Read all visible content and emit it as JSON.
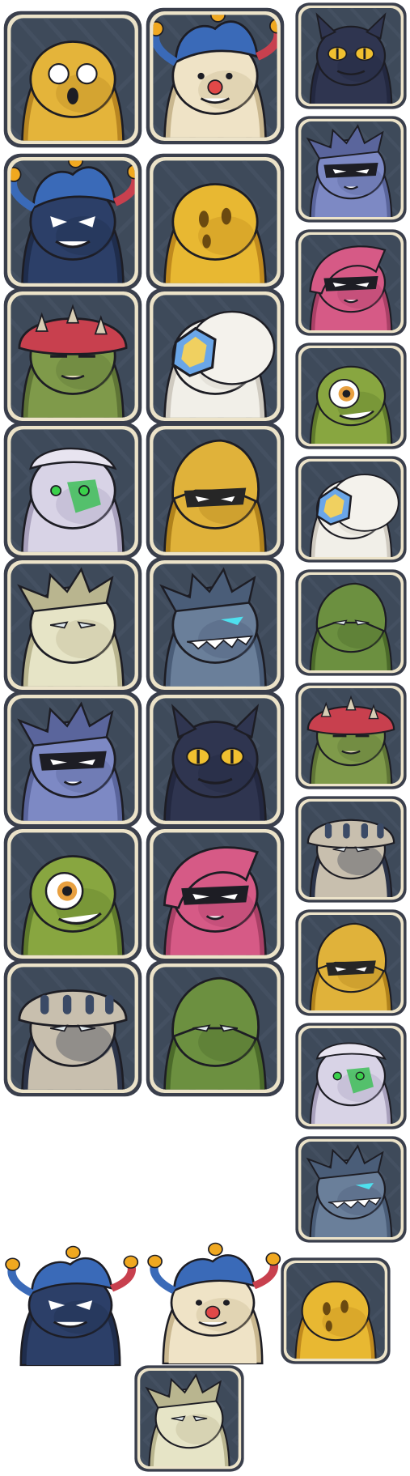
{
  "colors": {
    "frame_outer": "#3a3f4c",
    "frame_inner": "#ece3c9",
    "tile_bg": "#3e4a5a",
    "tile_pattern": "#4a5668",
    "outline": "#1d1d24"
  },
  "portraits": [
    {
      "col": 0,
      "row": 0,
      "creature": "yellow-blob-shocked-icon",
      "body": "#e4b43a",
      "shade": "#b88622",
      "eye": "white-round",
      "accent": "#ffffff",
      "framed": true
    },
    {
      "col": 1,
      "row": 0,
      "creature": "jester-clown-icon",
      "body": "#efe3c6",
      "shade": "#c9b78f",
      "eye": "dots",
      "accent": "#e04848",
      "hat": "jester",
      "framed": true
    },
    {
      "col": 2,
      "row": 0,
      "creature": "dark-cat-blob-icon",
      "body": "#2f3550",
      "shade": "#232840",
      "eye": "yellow-cat",
      "accent": "#f0c030",
      "horns": true,
      "framed": true
    },
    {
      "col": 0,
      "row": 1,
      "creature": "blue-jester-icon",
      "body": "#2c3f68",
      "shade": "#1f2d4c",
      "eye": "angry",
      "accent": "#3a6ab8",
      "hat": "jester",
      "framed": true
    },
    {
      "col": 1,
      "row": 1,
      "creature": "yellow-ghost-icon",
      "body": "#e8b832",
      "shade": "#c08a1e",
      "eye": "hollow",
      "accent": "#6b4a10",
      "framed": true
    },
    {
      "col": 2,
      "row": 1,
      "creature": "masked-wolf-icon",
      "body": "#7d89c4",
      "shade": "#5a659c",
      "eye": "mask",
      "accent": "#ffffff",
      "spikes": true,
      "framed": true
    },
    {
      "col": 2,
      "row": 2,
      "creature": "pink-hood-ninja-icon",
      "body": "#d65a86",
      "shade": "#a94066",
      "eye": "mask",
      "accent": "#f3f3f3",
      "hood": true,
      "framed": true
    },
    {
      "col": 0,
      "row": 2,
      "creature": "mushroom-zombie-icon",
      "body": "#7f9a4a",
      "shade": "#5f7536",
      "eye": "tired",
      "accent": "#c83a48",
      "mushroom": true,
      "framed": true
    },
    {
      "col": 1,
      "row": 2,
      "creature": "shield-sheep-icon",
      "body": "#f1efe8",
      "shade": "#cfcac0",
      "eye": "none",
      "accent": "#6aa6e8",
      "shield": true,
      "framed": true
    },
    {
      "col": 2,
      "row": 3,
      "creature": "green-cyclops-worm-icon",
      "body": "#88a640",
      "shade": "#5f7a2c",
      "eye": "cyclops",
      "accent": "#e8a040",
      "framed": true
    },
    {
      "col": 0,
      "row": 3,
      "creature": "white-hair-cyborg-icon",
      "body": "#d8d3e6",
      "shade": "#a8a0bc",
      "eye": "green-scale",
      "accent": "#47c060",
      "framed": true
    },
    {
      "col": 1,
      "row": 3,
      "creature": "gold-helmet-knight-icon",
      "body": "#e0b23a",
      "shade": "#b0821c",
      "eye": "visor",
      "accent": "#262626",
      "helmet": true,
      "framed": true
    },
    {
      "col": 2,
      "row": 4,
      "creature": "shield-sheep-small-icon",
      "body": "#f1efe8",
      "shade": "#cfcac0",
      "eye": "none",
      "accent": "#6aa6e8",
      "shield": true,
      "framed": true
    },
    {
      "col": 0,
      "row": 4,
      "creature": "white-dragon-icon",
      "body": "#e6e4c6",
      "shade": "#b9b58f",
      "eye": "slit",
      "accent": "#7ec24a",
      "spikes": true,
      "framed": true
    },
    {
      "col": 1,
      "row": 4,
      "creature": "blue-shark-dragon-icon",
      "body": "#6a7f9a",
      "shade": "#4a5d78",
      "eye": "glow-cyan",
      "accent": "#4ee0ee",
      "spikes": true,
      "framed": true
    },
    {
      "col": 2,
      "row": 5,
      "creature": "green-armor-knight-icon",
      "body": "#6c9040",
      "shade": "#4b6a2a",
      "eye": "slit",
      "accent": "#9cc460",
      "helmet": true,
      "framed": true
    },
    {
      "col": 0,
      "row": 5,
      "creature": "masked-wolf-large-icon",
      "body": "#7d89c4",
      "shade": "#5a659c",
      "eye": "mask",
      "accent": "#ffffff",
      "spikes": true,
      "framed": true
    },
    {
      "col": 1,
      "row": 5,
      "creature": "dark-cat-blob-large-icon",
      "body": "#2f3550",
      "shade": "#232840",
      "eye": "yellow-cat",
      "accent": "#f0c030",
      "horns": true,
      "framed": true
    },
    {
      "col": 2,
      "row": 6,
      "creature": "mushroom-zombie-small-icon",
      "body": "#7f9a4a",
      "shade": "#5f7536",
      "eye": "tired",
      "accent": "#c83a48",
      "mushroom": true,
      "framed": true
    },
    {
      "col": 0,
      "row": 6,
      "creature": "green-cyclops-worm-large-icon",
      "body": "#88a640",
      "shade": "#5f7a2c",
      "eye": "cyclops",
      "accent": "#e8a040",
      "framed": true
    },
    {
      "col": 1,
      "row": 6,
      "creature": "pink-hood-ninja-large-icon",
      "body": "#d65a86",
      "shade": "#a94066",
      "eye": "mask",
      "accent": "#f3f3f3",
      "hood": true,
      "framed": true
    },
    {
      "col": 2,
      "row": 7,
      "creature": "mushroom-hat-shadow-icon",
      "body": "#c8bfae",
      "shade": "#2c3449",
      "eye": "slit",
      "accent": "#3b4a66",
      "mushroom": true,
      "framed": true
    },
    {
      "col": 0,
      "row": 7,
      "creature": "mushroom-hat-shadow-large-icon",
      "body": "#c8bfae",
      "shade": "#2c3449",
      "eye": "slit",
      "accent": "#3b4a66",
      "mushroom": true,
      "framed": true
    },
    {
      "col": 1,
      "row": 7,
      "creature": "green-armor-knight-large-icon",
      "body": "#6c9040",
      "shade": "#4b6a2a",
      "eye": "slit",
      "accent": "#9cc460",
      "helmet": true,
      "framed": true
    },
    {
      "col": 2,
      "row": 8,
      "creature": "gold-helmet-knight-small-icon",
      "body": "#e0b23a",
      "shade": "#b0821c",
      "eye": "visor",
      "accent": "#262626",
      "helmet": true,
      "framed": true
    },
    {
      "col": 2,
      "row": 9,
      "creature": "white-hair-cyborg-small-icon",
      "body": "#d8d3e6",
      "shade": "#a8a0bc",
      "eye": "green-scale",
      "accent": "#47c060",
      "framed": true
    },
    {
      "col": 2,
      "row": 10,
      "creature": "blue-shark-dragon-small-icon",
      "body": "#6a7f9a",
      "shade": "#4a5d78",
      "eye": "glow-cyan",
      "accent": "#4ee0ee",
      "spikes": true,
      "framed": true
    },
    {
      "col": 0,
      "row": 11,
      "creature": "blue-jester-cutout-icon",
      "body": "#2c3f68",
      "shade": "#1f2d4c",
      "eye": "angry",
      "accent": "#3a6ab8",
      "hat": "jester",
      "framed": false
    },
    {
      "col": 1,
      "row": 11,
      "creature": "jester-clown-cutout-icon",
      "body": "#efe3c6",
      "shade": "#c9b78f",
      "eye": "dots",
      "accent": "#e04848",
      "hat": "jester",
      "framed": false
    },
    {
      "col": 2,
      "row": 11,
      "creature": "yellow-ghost-small-icon",
      "body": "#e8b832",
      "shade": "#c08a1e",
      "eye": "hollow",
      "accent": "#6b4a10",
      "framed": true
    },
    {
      "col": 1,
      "row": 12,
      "creature": "white-dragon-small-icon",
      "body": "#e6e4c6",
      "shade": "#b9b58f",
      "eye": "slit",
      "accent": "#7ec24a",
      "spikes": true,
      "framed": true
    }
  ]
}
